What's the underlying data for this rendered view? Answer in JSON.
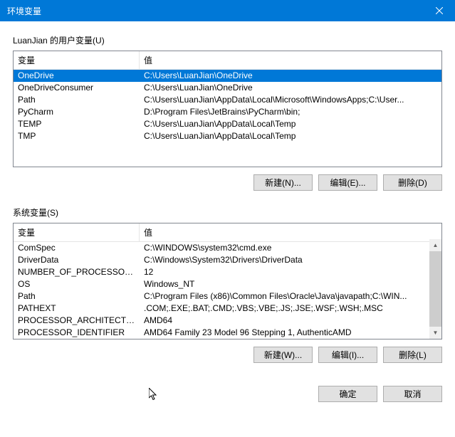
{
  "window": {
    "title": "环境变量"
  },
  "user_section": {
    "label": "LuanJian 的用户变量(U)",
    "headers": {
      "name": "变量",
      "value": "值"
    },
    "rows": [
      {
        "name": "OneDrive",
        "value": "C:\\Users\\LuanJian\\OneDrive",
        "selected": true
      },
      {
        "name": "OneDriveConsumer",
        "value": "C:\\Users\\LuanJian\\OneDrive",
        "selected": false
      },
      {
        "name": "Path",
        "value": "C:\\Users\\LuanJian\\AppData\\Local\\Microsoft\\WindowsApps;C:\\User...",
        "selected": false
      },
      {
        "name": "PyCharm",
        "value": "D:\\Program Files\\JetBrains\\PyCharm\\bin;",
        "selected": false
      },
      {
        "name": "TEMP",
        "value": "C:\\Users\\LuanJian\\AppData\\Local\\Temp",
        "selected": false
      },
      {
        "name": "TMP",
        "value": "C:\\Users\\LuanJian\\AppData\\Local\\Temp",
        "selected": false
      }
    ],
    "buttons": {
      "new": "新建(N)...",
      "edit": "编辑(E)...",
      "delete": "删除(D)"
    }
  },
  "system_section": {
    "label": "系统变量(S)",
    "headers": {
      "name": "变量",
      "value": "值"
    },
    "rows": [
      {
        "name": "ComSpec",
        "value": "C:\\WINDOWS\\system32\\cmd.exe"
      },
      {
        "name": "DriverData",
        "value": "C:\\Windows\\System32\\Drivers\\DriverData"
      },
      {
        "name": "NUMBER_OF_PROCESSORS",
        "value": "12"
      },
      {
        "name": "OS",
        "value": "Windows_NT"
      },
      {
        "name": "Path",
        "value": "C:\\Program Files (x86)\\Common Files\\Oracle\\Java\\javapath;C:\\WIN..."
      },
      {
        "name": "PATHEXT",
        "value": ".COM;.EXE;.BAT;.CMD;.VBS;.VBE;.JS;.JSE;.WSF;.WSH;.MSC"
      },
      {
        "name": "PROCESSOR_ARCHITECTURE",
        "value": "AMD64"
      },
      {
        "name": "PROCESSOR_IDENTIFIER",
        "value": "AMD64 Family 23 Model 96 Stepping 1, AuthenticAMD"
      }
    ],
    "buttons": {
      "new": "新建(W)...",
      "edit": "编辑(I)...",
      "delete": "删除(L)"
    }
  },
  "footer": {
    "ok": "确定",
    "cancel": "取消"
  }
}
